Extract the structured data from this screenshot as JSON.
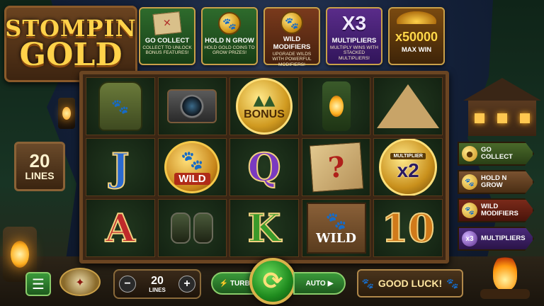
{
  "logo": {
    "line1": "STOMPIN",
    "line2": "GOLD"
  },
  "features": [
    {
      "title": "GO COLLECT",
      "desc": "COLLECT TO UNLOCK BONUS FEATURES!",
      "theme": "green",
      "icon": "treasure-map-icon"
    },
    {
      "title": "HOLD N GROW",
      "desc": "HOLD GOLD COINS TO GROW PRIZES!",
      "theme": "green",
      "icon": "gold-paw-coin-icon"
    },
    {
      "title": "WILD MODIFIERS",
      "desc": "UPGRADE WILDS WITH POWERFUL MODIFIERS!",
      "theme": "brown",
      "icon": "paw-medallion-icon"
    },
    {
      "title": "MULTIPLIERS",
      "desc": "MULTIPLY WINS WITH STACKED MULTIPLIERS!",
      "theme": "purple",
      "icon_text": "X3"
    },
    {
      "title": "MAX WIN",
      "value": "x50000",
      "theme": "gold",
      "icon": "gold-pile-icon"
    }
  ],
  "reels": {
    "row1": [
      "backpack",
      "camera",
      "bonus",
      "lantern",
      "tent"
    ],
    "row2": [
      "J",
      "wild",
      "Q",
      "map",
      "multiplier"
    ],
    "row3": [
      "A",
      "binoculars",
      "K",
      "wild-sign",
      "10"
    ],
    "bonus_label": "BONUS",
    "wild_label": "WILD",
    "multiplier_label": "MULTIPLIER",
    "multiplier_value": "x2",
    "letter_colors": {
      "J": "#2a6ad0",
      "Q": "#7a3ac0",
      "A": "#c02a2a",
      "K": "#3a9a2a",
      "10": "#d07a1a"
    }
  },
  "lines_box": {
    "number": "20",
    "label": "LINES"
  },
  "signpost": [
    {
      "line1": "GO",
      "line2": "COLLECT",
      "icon": "gold-coin-icon"
    },
    {
      "line1": "HOLD N",
      "line2": "GROW",
      "icon": "paw-coin-icon"
    },
    {
      "line1": "WILD",
      "line2": "MODIFIERS",
      "icon": "paw-medallion-icon"
    },
    {
      "line1": "MULTIPLIERS",
      "line2": "",
      "icon_text": "x3"
    }
  ],
  "controls": {
    "lines_value": "20",
    "lines_label": "LINES",
    "minus": "−",
    "plus": "+",
    "turbo": "TURBO",
    "auto": "AUTO",
    "good_luck": "GOOD LUCK!"
  },
  "colors": {
    "accent_gold": "#ffd24a",
    "spin_green": "#1e8a1e",
    "wood": "#6b4522"
  }
}
